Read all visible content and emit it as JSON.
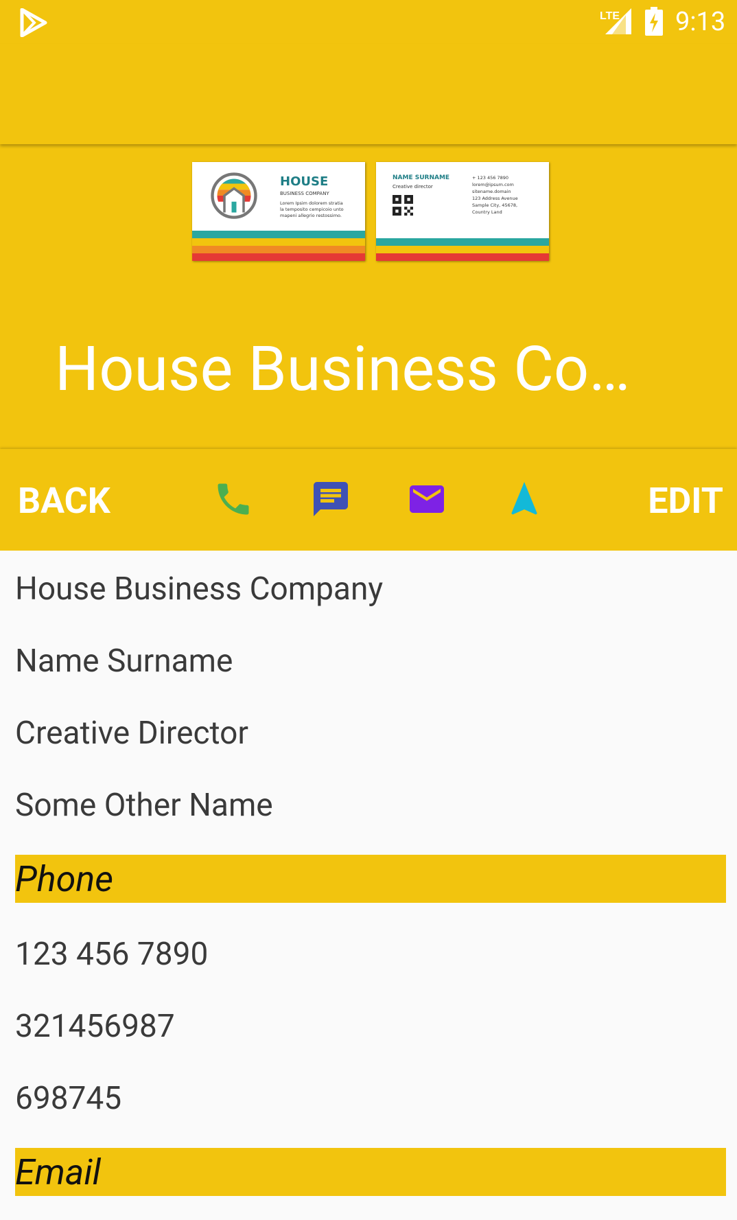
{
  "status_bar": {
    "time": "9:13",
    "network": "LTE"
  },
  "card_front": {
    "brand": "HOUSE",
    "sub": "BUSINESS COMPANY",
    "lorem": [
      "Lorem Ipsim dolorem stratia",
      "la temposito cempicoio unto",
      "mapeni allegrio restossimo."
    ]
  },
  "card_back": {
    "name": "NAME SURNAME",
    "role": "Creative director",
    "lines": [
      "+ 123 456 7890",
      "lorem@ipsum.com",
      "sitename.domain",
      "123 Address Avenue",
      "Sample City, 45678,",
      "Country Land"
    ]
  },
  "header": {
    "title": "House Business Com..."
  },
  "actions": {
    "back": "BACK",
    "edit": "EDIT"
  },
  "details": {
    "company": "House Business Company",
    "name": "Name Surname",
    "title": "Creative Director",
    "other_name": "Some Other Name",
    "phone_header": "Phone",
    "phones": [
      "123 456 7890",
      "321456987",
      "698745"
    ],
    "email_header": "Email"
  },
  "colors": {
    "accent": "#f2c40e",
    "phone": "#4caf50",
    "message": "#3f51b5",
    "email": "#7e22e5",
    "navigate": "#13b9d8"
  }
}
